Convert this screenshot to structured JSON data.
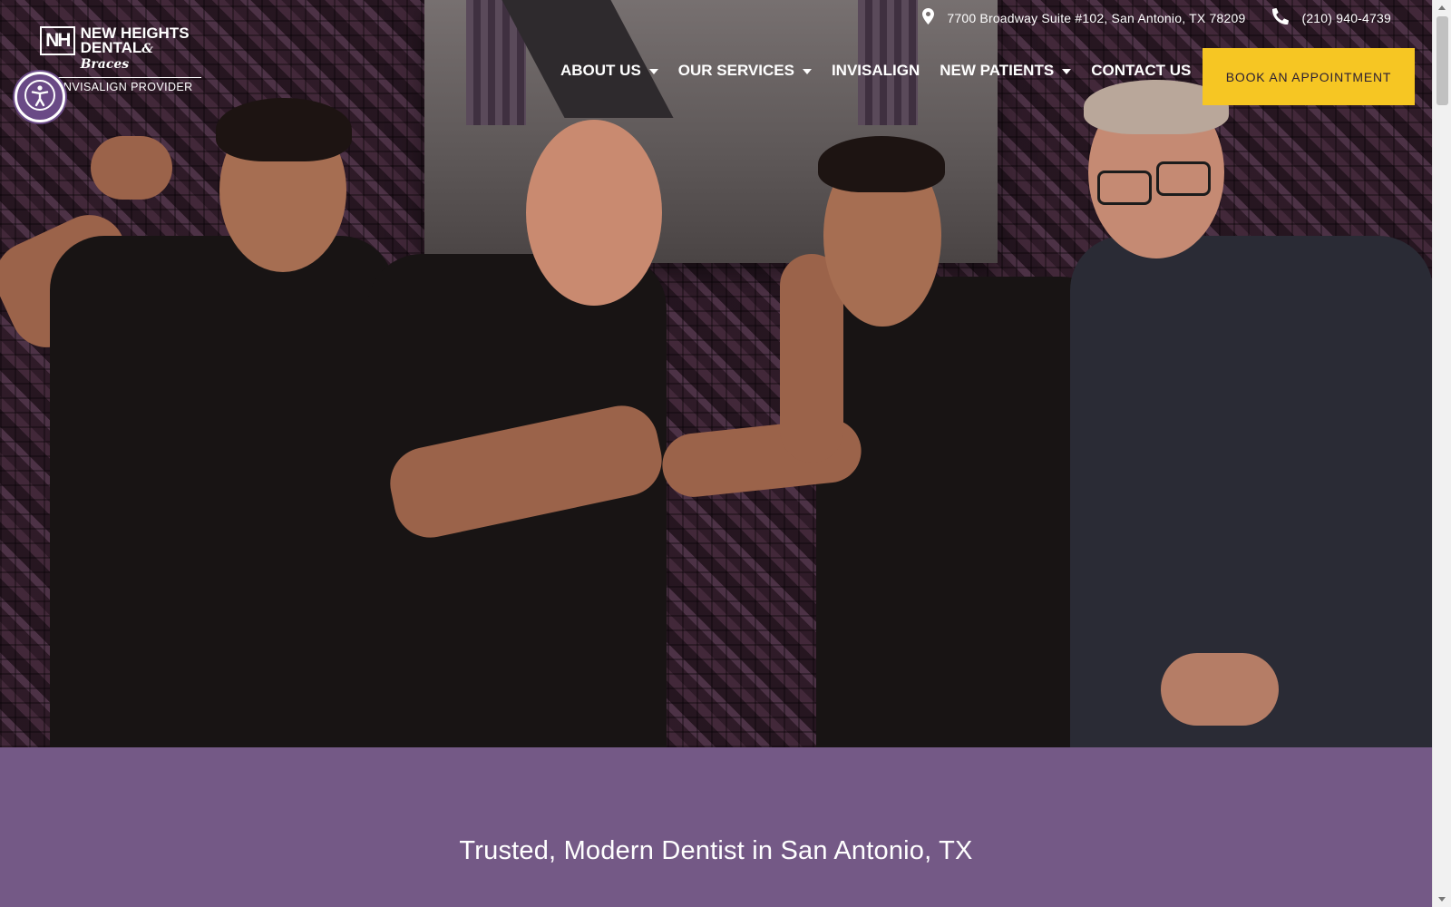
{
  "topbar": {
    "address": "7700 Broadway Suite #102, San Antonio, TX 78209",
    "phone": "(210) 940-4739"
  },
  "logo": {
    "mark": "NH",
    "line1": "NEW HEIGHTS",
    "line2": "DENTAL",
    "line2_suffix": "& Braces",
    "tagline": "AN INVISALIGN PROVIDER"
  },
  "nav": {
    "items": [
      {
        "label": "ABOUT US",
        "has_dropdown": true
      },
      {
        "label": "OUR SERVICES",
        "has_dropdown": true
      },
      {
        "label": "INVISALIGN",
        "has_dropdown": false
      },
      {
        "label": "NEW PATIENTS",
        "has_dropdown": true
      },
      {
        "label": "CONTACT US",
        "has_dropdown": false
      }
    ],
    "cta": "BOOK AN APPOINTMENT"
  },
  "hero": {
    "heading": "Trusted, Modern Dentist in San Antonio, TX"
  },
  "colors": {
    "purple_band": "#745986",
    "cta_yellow": "#f6c623",
    "accessibility_purple": "#6a4a86"
  },
  "icons": {
    "address": "map-pin-icon",
    "phone": "phone-icon",
    "accessibility": "accessibility-icon",
    "dropdown": "caret-down-icon"
  }
}
